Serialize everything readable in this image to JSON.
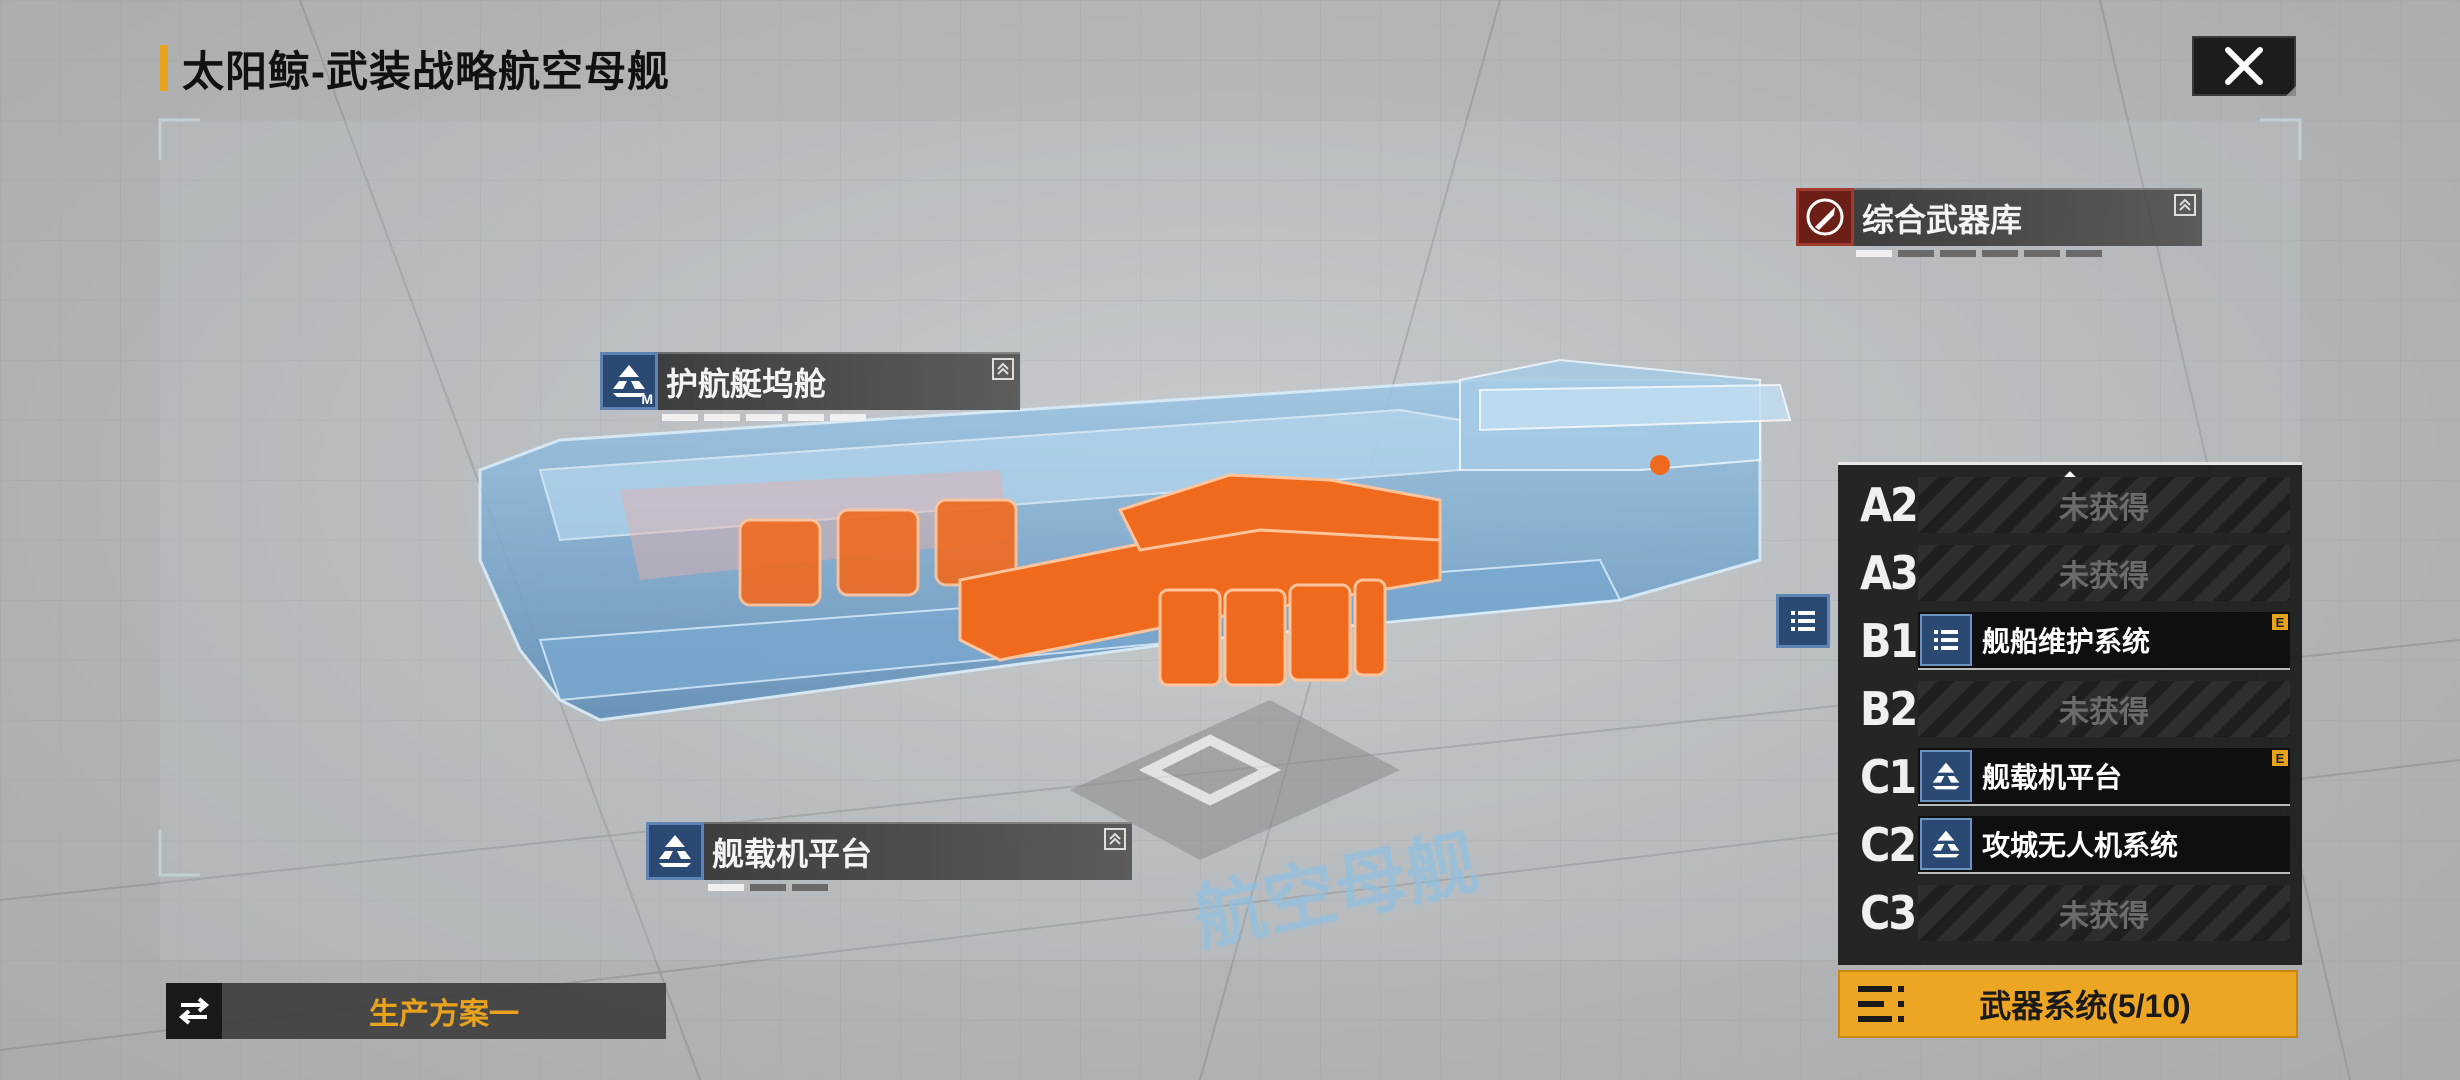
{
  "title": "太阳鲸-武装战略航空母舰",
  "modules": {
    "arsenal": "综合武器库",
    "escort_dock": "护航艇坞舱",
    "escort_dock_tag": "M",
    "carrier_platform": "舰载机平台"
  },
  "slots": [
    {
      "code": "A2",
      "status": "未获得",
      "filled": false
    },
    {
      "code": "A3",
      "status": "未获得",
      "filled": false
    },
    {
      "code": "B1",
      "name": "舰船维护系统",
      "filled": true,
      "badge": "E",
      "icon": "list-icon"
    },
    {
      "code": "B2",
      "status": "未获得",
      "filled": false
    },
    {
      "code": "C1",
      "name": "舰载机平台",
      "filled": true,
      "badge": "E",
      "icon": "carrier-icon"
    },
    {
      "code": "C2",
      "name": "攻城无人机系统",
      "filled": true,
      "icon": "carrier-icon"
    },
    {
      "code": "C3",
      "status": "未获得",
      "filled": false
    }
  ],
  "weapon_system": "武器系统(5/10)",
  "production_plan": "生产方案一",
  "watermark": "航空母舰",
  "colors": {
    "accent": "#eda623",
    "ship_blue": "#7fb2db",
    "highlight_orange": "#f06a1e",
    "panel_dark": "#181818"
  }
}
